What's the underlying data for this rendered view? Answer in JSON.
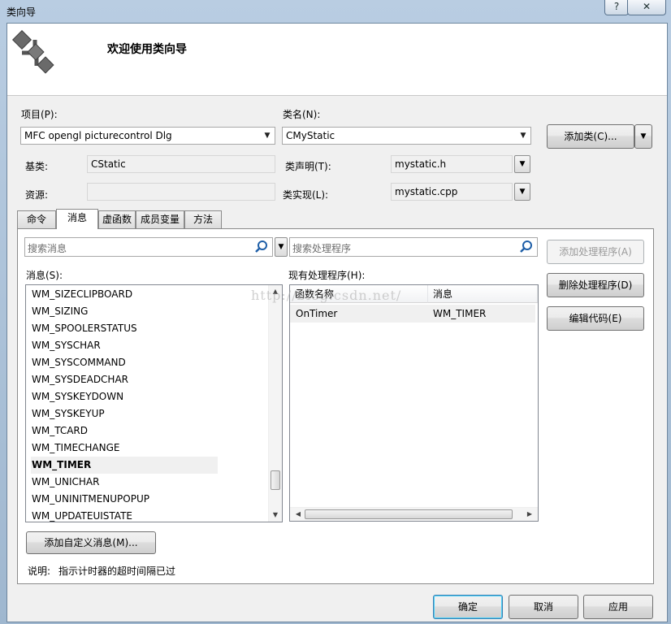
{
  "window": {
    "title": "类向导",
    "help_label": "?",
    "close_label": "✕"
  },
  "header": {
    "title": "欢迎使用类向导",
    "logo_icon": "class-wizard-logo-icon"
  },
  "form": {
    "project_label": "项目(P):",
    "project_value": "MFC opengl picturecontrol Dlg",
    "classname_label": "类名(N):",
    "classname_value": "CMyStatic",
    "add_class_label": "添加类(C)...",
    "base_label": "基类:",
    "base_value": "CStatic",
    "decl_label": "类声明(T):",
    "decl_value": "mystatic.h",
    "resource_label": "资源:",
    "resource_value": "",
    "impl_label": "类实现(L):",
    "impl_value": "mystatic.cpp"
  },
  "tabs": [
    {
      "label": "命令"
    },
    {
      "label": "消息"
    },
    {
      "label": "虚函数"
    },
    {
      "label": "成员变量"
    },
    {
      "label": "方法"
    }
  ],
  "messages_panel": {
    "search_placeholder": "搜索消息",
    "label": "消息(S):",
    "items": [
      "WM_SIZECLIPBOARD",
      "WM_SIZING",
      "WM_SPOOLERSTATUS",
      "WM_SYSCHAR",
      "WM_SYSCOMMAND",
      "WM_SYSDEADCHAR",
      "WM_SYSKEYDOWN",
      "WM_SYSKEYUP",
      "WM_TCARD",
      "WM_TIMECHANGE",
      "WM_TIMER",
      "WM_UNICHAR",
      "WM_UNINITMENUPOPUP",
      "WM_UPDATEUISTATE"
    ],
    "selected": "WM_TIMER",
    "add_custom_label": "添加自定义消息(M)...",
    "description_label": "说明:",
    "description_text": "指示计时器的超时间隔已过"
  },
  "handlers_panel": {
    "search_placeholder": "搜索处理程序",
    "label": "现有处理程序(H):",
    "columns": [
      "函数名称",
      "消息"
    ],
    "rows": [
      [
        "OnTimer",
        "WM_TIMER"
      ]
    ]
  },
  "side_buttons": {
    "add_handler": "添加处理程序(A)",
    "delete_handler": "删除处理程序(D)",
    "edit_code": "编辑代码(E)"
  },
  "footer": {
    "ok": "确定",
    "cancel": "取消",
    "apply": "应用"
  },
  "watermark": "http://blog.csdn.net/",
  "colors": {
    "selection_bg": "#f0f0f0",
    "default_button_border": "#3c7fb1"
  }
}
